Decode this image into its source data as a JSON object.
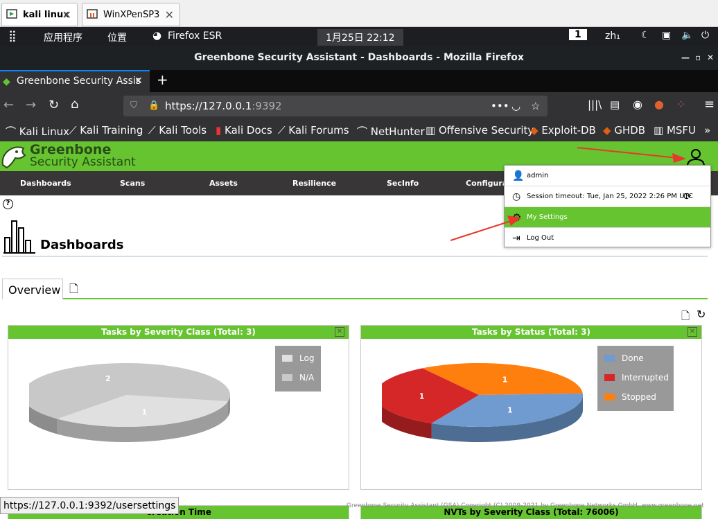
{
  "vm_tabs": [
    {
      "label": "kali linux",
      "active": true
    },
    {
      "label": "WinXPenSP3",
      "active": false
    }
  ],
  "panel": {
    "apps": "应用程序",
    "places": "位置",
    "browser": "Firefox ESR",
    "clock": "1月25日  22:12",
    "workspace": "1",
    "lang": "zh₁"
  },
  "window_title": "Greenbone Security Assistant - Dashboards - Mozilla Firefox",
  "browser_tab": "Greenbone Security Assis",
  "url": {
    "host": "https://127.0.0.1",
    "port": ":9392"
  },
  "bookmarks": [
    "Kali Linux",
    "Kali Training",
    "Kali Tools",
    "Kali Docs",
    "Kali Forums",
    "NetHunter",
    "Offensive Security",
    "Exploit-DB",
    "GHDB",
    "MSFU"
  ],
  "brand": {
    "line1": "Greenbone",
    "line2": "Security Assistant"
  },
  "nav": [
    "Dashboards",
    "Scans",
    "Assets",
    "Resilience",
    "SecInfo",
    "Configurati"
  ],
  "page_title": "Dashboards",
  "tabs": {
    "overview": "Overview"
  },
  "user_menu": {
    "user": "admin",
    "session": "Session timeout: Tue, Jan 25, 2022 2:26 PM UTC",
    "settings": "My Settings",
    "logout": "Log Out"
  },
  "chart_data": [
    {
      "type": "pie",
      "title": "Tasks by Severity Class (Total: 3)",
      "labels": [
        "Log",
        "N/A"
      ],
      "values": [
        1,
        2
      ],
      "colors": [
        "#e0e0e0",
        "#c8c8c8"
      ]
    },
    {
      "type": "pie",
      "title": "Tasks by Status (Total: 3)",
      "labels": [
        "Done",
        "Interrupted",
        "Stopped"
      ],
      "values": [
        1,
        1,
        1
      ],
      "colors": [
        "#6f9bd1",
        "#d62728",
        "#ff7f0e"
      ]
    }
  ],
  "lower_panels": {
    "left": "Creation Time",
    "right": "NVTs by Severity Class (Total: 76006)"
  },
  "footer": "Greenbone Security Assistant (GSA) Copyright (C) 2009-2021 by Greenbone Networks GmbH, www.greenbone.net",
  "status_url": "https://127.0.0.1:9392/usersettings"
}
